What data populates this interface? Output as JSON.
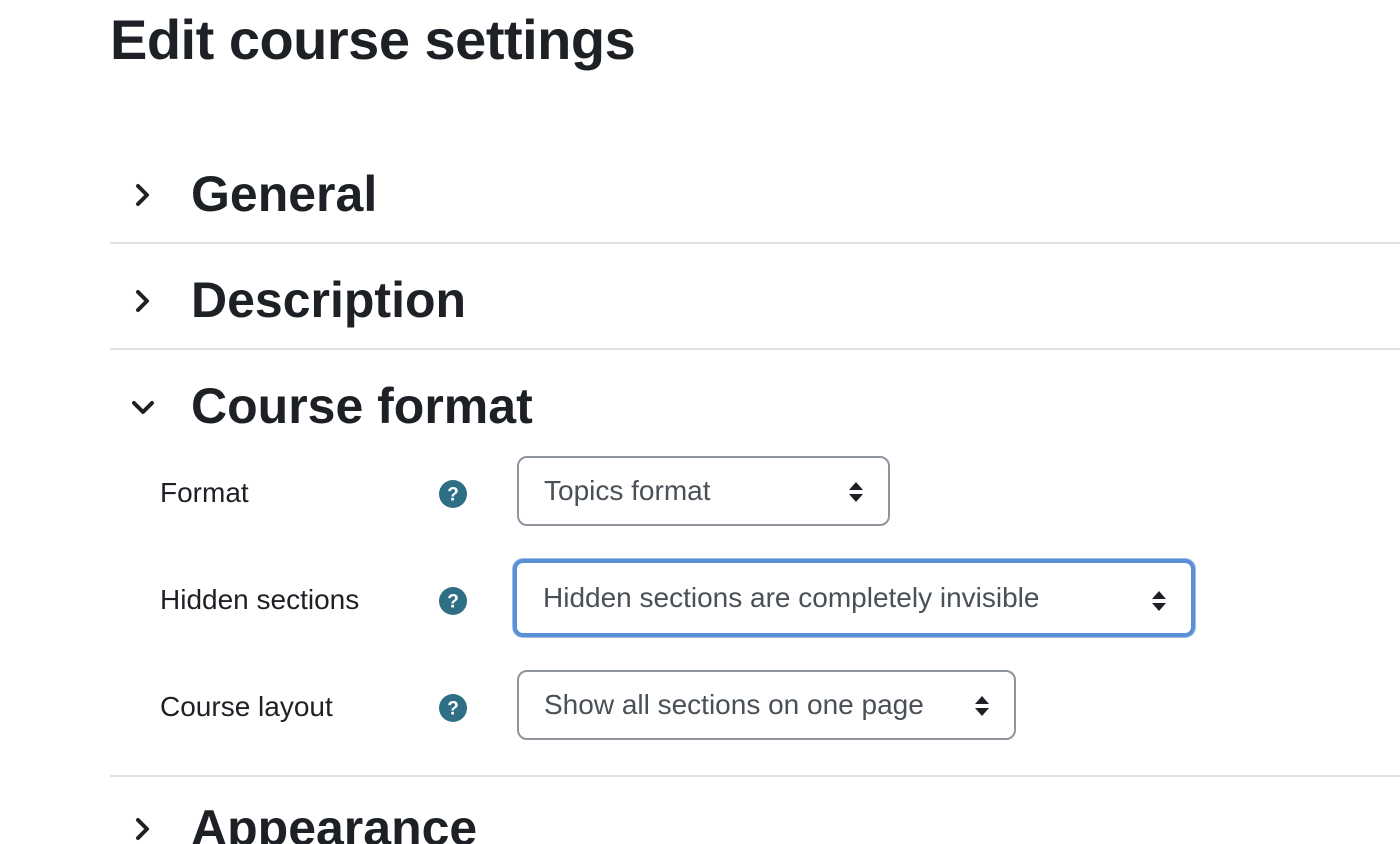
{
  "page": {
    "title": "Edit course settings"
  },
  "sections": {
    "general": {
      "title": "General",
      "expanded": false
    },
    "description": {
      "title": "Description",
      "expanded": false
    },
    "course_format": {
      "title": "Course format",
      "expanded": true,
      "fields": {
        "format": {
          "label": "Format",
          "value": "Topics format",
          "icon": "help-icon"
        },
        "hidden_sections": {
          "label": "Hidden sections",
          "value": "Hidden sections are completely invisible",
          "icon": "help-icon",
          "focused": true
        },
        "course_layout": {
          "label": "Course layout",
          "value": "Show all sections on one page",
          "icon": "help-icon"
        }
      }
    },
    "appearance": {
      "title": "Appearance",
      "expanded": false
    }
  },
  "colors": {
    "text": "#1d2125",
    "help_icon": "#2f6f85",
    "divider": "#dee2e6",
    "select_border": "#8f959e",
    "focus_ring": "#5b8fd6",
    "select_text": "#495057"
  }
}
